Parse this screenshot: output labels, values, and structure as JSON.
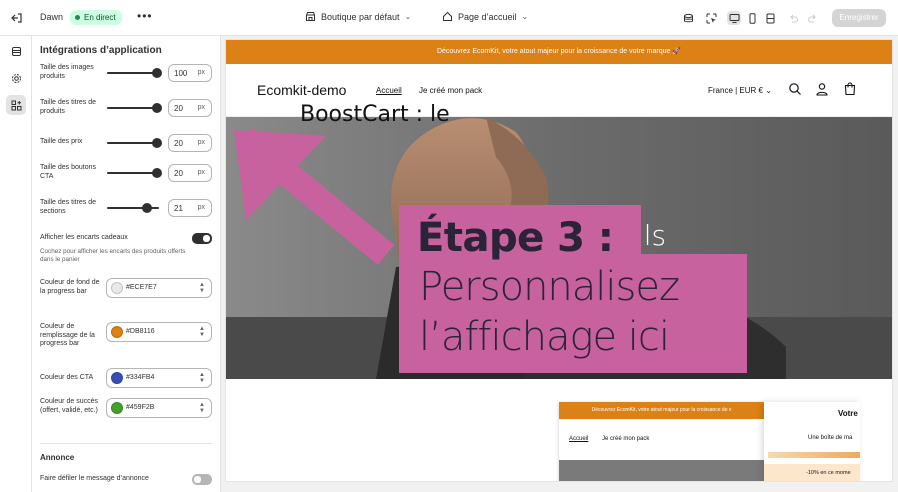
{
  "topbar": {
    "theme_name": "Dawn",
    "status_badge": "En direct",
    "more_label": "•••",
    "theme_select": "Boutique par défaut",
    "page_select": "Page d’accueil",
    "save_label": "Enregistrer"
  },
  "sidebar": {
    "title": "Intégrations d’application",
    "settings": [
      {
        "label": "Taille des images produits",
        "value": "100",
        "unit": "px",
        "level": 1.0
      },
      {
        "label": "Taille des titres de produits",
        "value": "20",
        "unit": "px",
        "level": 1.0
      },
      {
        "label": "Taille des prix",
        "value": "20",
        "unit": "px",
        "level": 1.0
      },
      {
        "label": "Taille des boutons CTA",
        "value": "20",
        "unit": "px",
        "level": 1.0
      },
      {
        "label": "Taille des titres de sections",
        "value": "21",
        "unit": "px",
        "level": 0.78
      }
    ],
    "gift_toggle": {
      "label": "Afficher les encarts cadeaux",
      "help": "Cochez pour afficher les encarts des produits offerts dans le panier",
      "on": true
    },
    "colors": [
      {
        "label": "Couleur de fond de la progress bar",
        "hex": "#ECE7E7",
        "swatch": "#ECE7E7"
      },
      {
        "label": "Couleur de remplissage de la progress bar",
        "hex": "#DB8116",
        "swatch": "#DB8116"
      },
      {
        "label": "Couleur des CTA",
        "hex": "#334FB4",
        "swatch": "#334FB4"
      },
      {
        "label": "Couleur de succès (offert, validé, etc.)",
        "hex": "#459F2B",
        "swatch": "#459F2B"
      }
    ],
    "announce_section": "Annonce",
    "announce_toggle": {
      "label": "Faire défiler le message d’annonce",
      "on": false
    }
  },
  "preview": {
    "announcement": "Découvrez EcomKit, votre atout majeur pour la croissance de votre marque 🚀",
    "logo": "Ecomkit-demo",
    "nav": [
      "Accueil",
      "Je créé mon pack"
    ],
    "locale": "France | EUR € ⌄",
    "hero_title": "ils",
    "boost_title": "BoostCart : le",
    "mini": {
      "announcement": "Découvrez EcomKit, votre atout majeur pour la croissance de v",
      "nav": [
        "Accueil",
        "Je créé mon pack"
      ]
    },
    "cart": {
      "title": "Votre",
      "message": "Une boîte de ma",
      "footer": "-10% en ce mome"
    }
  },
  "overlay": {
    "step": "Étape 3 :",
    "line1": "Personnalisez",
    "line2": "l’affichage ici",
    "color": "#C8629E"
  }
}
